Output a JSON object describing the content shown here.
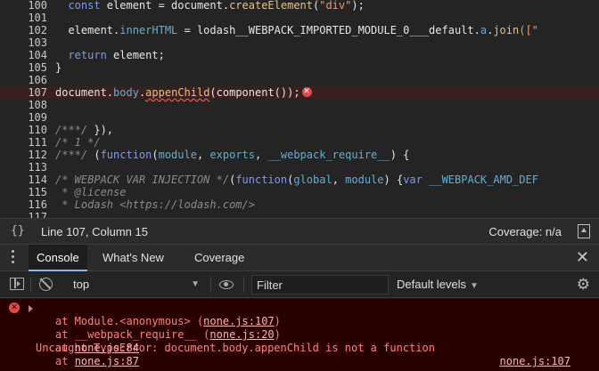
{
  "editor": {
    "lines": [
      {
        "num": "100",
        "tokens": [
          {
            "t": "  ",
            "c": "plain"
          },
          {
            "t": "const",
            "c": "kw"
          },
          {
            "t": " element = document.",
            "c": "plain"
          },
          {
            "t": "createElement",
            "c": "fn"
          },
          {
            "t": "(",
            "c": "plain"
          },
          {
            "t": "\"div\"",
            "c": "str"
          },
          {
            "t": ");",
            "c": "plain"
          }
        ]
      },
      {
        "num": "101",
        "tokens": []
      },
      {
        "num": "102",
        "tokens": [
          {
            "t": "  element.",
            "c": "plain"
          },
          {
            "t": "innerHTML",
            "c": "prop"
          },
          {
            "t": " = lodash__WEBPACK_IMPORTED_MODULE_0___default.",
            "c": "plain"
          },
          {
            "t": "a",
            "c": "prop"
          },
          {
            "t": ".",
            "c": "plain"
          },
          {
            "t": "join",
            "c": "fn"
          },
          {
            "t": "([\"",
            "c": "str"
          }
        ]
      },
      {
        "num": "103",
        "tokens": []
      },
      {
        "num": "104",
        "tokens": [
          {
            "t": "  ",
            "c": "plain"
          },
          {
            "t": "return",
            "c": "kw"
          },
          {
            "t": " element;",
            "c": "plain"
          }
        ]
      },
      {
        "num": "105",
        "tokens": [
          {
            "t": "}",
            "c": "plain"
          }
        ]
      },
      {
        "num": "106",
        "tokens": []
      },
      {
        "num": "107",
        "error": true,
        "tokens": [
          {
            "t": "document.",
            "c": "plain"
          },
          {
            "t": "body",
            "c": "prop"
          },
          {
            "t": ".",
            "c": "plain"
          },
          {
            "t": "appenChild",
            "c": "fn squiggle"
          },
          {
            "t": "(component());",
            "c": "plain"
          }
        ]
      },
      {
        "num": "108",
        "tokens": []
      },
      {
        "num": "109",
        "tokens": []
      },
      {
        "num": "110",
        "tokens": [
          {
            "t": "/***/",
            "c": "comment"
          },
          {
            "t": " }),",
            "c": "plain"
          }
        ]
      },
      {
        "num": "111",
        "tokens": [
          {
            "t": "/* 1 */",
            "c": "comment"
          }
        ]
      },
      {
        "num": "112",
        "tokens": [
          {
            "t": "/***/",
            "c": "comment"
          },
          {
            "t": " (",
            "c": "plain"
          },
          {
            "t": "function",
            "c": "kw"
          },
          {
            "t": "(",
            "c": "plain"
          },
          {
            "t": "module",
            "c": "prop"
          },
          {
            "t": ", ",
            "c": "plain"
          },
          {
            "t": "exports",
            "c": "prop"
          },
          {
            "t": ", ",
            "c": "plain"
          },
          {
            "t": "__webpack_require__",
            "c": "prop"
          },
          {
            "t": ") {",
            "c": "plain"
          }
        ]
      },
      {
        "num": "113",
        "tokens": []
      },
      {
        "num": "114",
        "tokens": [
          {
            "t": "/* WEBPACK VAR INJECTION */",
            "c": "comment"
          },
          {
            "t": "(",
            "c": "plain"
          },
          {
            "t": "function",
            "c": "kw"
          },
          {
            "t": "(",
            "c": "plain"
          },
          {
            "t": "global",
            "c": "prop"
          },
          {
            "t": ", ",
            "c": "plain"
          },
          {
            "t": "module",
            "c": "prop"
          },
          {
            "t": ") {",
            "c": "plain"
          },
          {
            "t": "var",
            "c": "kw"
          },
          {
            "t": " ",
            "c": "plain"
          },
          {
            "t": "__WEBPACK_AMD_DEF",
            "c": "prop"
          }
        ]
      },
      {
        "num": "115",
        "tokens": [
          {
            "t": " * @license",
            "c": "comment"
          }
        ]
      },
      {
        "num": "116",
        "tokens": [
          {
            "t": " * Lodash <https://lodash.com/>",
            "c": "comment"
          }
        ]
      },
      {
        "num": "117",
        "tokens": []
      }
    ],
    "error_badge": "✕"
  },
  "status_bar": {
    "braces": "{}",
    "position": "Line 107, Column 15",
    "coverage": "Coverage: n/a"
  },
  "drawer": {
    "tabs": [
      {
        "label": "Console",
        "active": true
      },
      {
        "label": "What's New",
        "active": false
      },
      {
        "label": "Coverage",
        "active": false
      }
    ],
    "close": "✕"
  },
  "console_toolbar": {
    "context": "top",
    "filter_placeholder": "Filter",
    "levels": "Default levels"
  },
  "console_error": {
    "icon": "✕",
    "message": "Uncaught TypeError: document.body.appenChild is not a function",
    "source": "none.js:107",
    "frames": [
      {
        "prefix": "at Module.<anonymous> (",
        "link": "none.js:107",
        "suffix": ")"
      },
      {
        "prefix": "at __webpack_require__ (",
        "link": "none.js:20",
        "suffix": ")"
      },
      {
        "prefix": "at ",
        "link": "none.js:84",
        "suffix": ""
      },
      {
        "prefix": "at ",
        "link": "none.js:87",
        "suffix": ""
      }
    ]
  },
  "colors": {
    "background": "#242424",
    "error_bg": "#290000",
    "error_text": "#ff8080",
    "keyword": "#7a9bf0",
    "string": "#f29766",
    "property": "#5db0d7",
    "function": "#e8c37a",
    "comment": "#8a8a8a",
    "active_tab_underline": "#8ab4f8"
  }
}
